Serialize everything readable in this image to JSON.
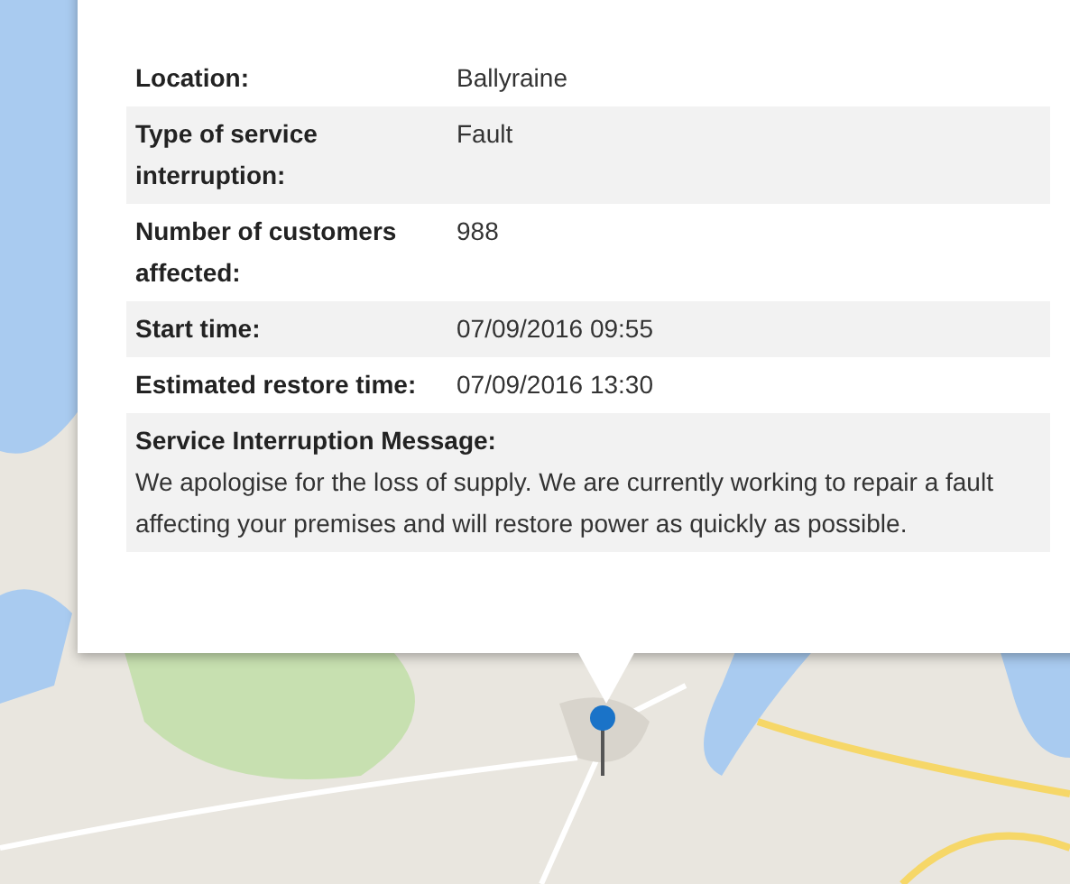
{
  "info_window": {
    "rows": [
      {
        "label": "Location:",
        "value": "Ballyraine"
      },
      {
        "label": "Type of service interruption:",
        "value": "Fault"
      },
      {
        "label": "Number of customers affected:",
        "value": "988"
      },
      {
        "label": "Start time:",
        "value": "07/09/2016 09:55"
      },
      {
        "label": "Estimated restore time:",
        "value": "07/09/2016 13:30"
      }
    ],
    "message": {
      "label": "Service Interruption Message:",
      "value": "We apologise for the loss of supply. We are currently working to repair a fault affecting your premises and will restore power as quickly as possible."
    }
  }
}
